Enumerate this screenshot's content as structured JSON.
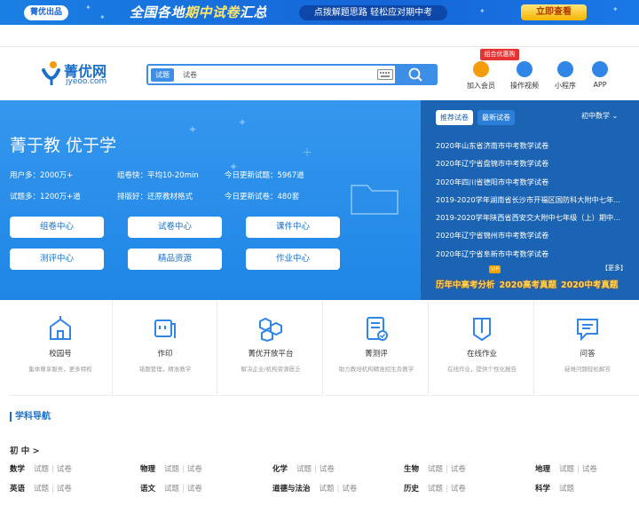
{
  "banner": {
    "chip": "菁优出品",
    "headline_a": "全国各地",
    "headline_b": "期中试卷",
    "headline_c": "汇总",
    "pill": "点拨解题思路  轻松应对期中考",
    "cta": "立即查看"
  },
  "header": {
    "logo_name": "菁优网",
    "logo_domain": "jyeoo.com",
    "search_tabs": [
      "试题",
      "试卷"
    ],
    "promo": "组合优惠购",
    "icons": [
      {
        "label": "加入会员",
        "color": "#f59c0d"
      },
      {
        "label": "操作视频",
        "color": "#2f86e6"
      },
      {
        "label": "小程序",
        "color": "#2f86e6"
      },
      {
        "label": "APP",
        "color": "#2f86e6"
      }
    ]
  },
  "hero": {
    "slogan": "菁于教 优于学",
    "stats": [
      "用户多：2000万+",
      "组卷快：平均10-20min",
      "今日更新试题：5967道",
      "试题多：1200万+道",
      "排版好：还原教材格式",
      "今日更新试卷：480套"
    ],
    "buttons": [
      "组卷中心",
      "试卷中心",
      "课件中心",
      "测评中心",
      "精品资源",
      "作业中心"
    ],
    "tabs": [
      "推荐试卷",
      "最新试卷"
    ],
    "subject": "初中数学",
    "papers": [
      "2020年山东省济南市中考数学试卷",
      "2020年辽宁省盘锦市中考数学试卷",
      "2020年四川省德阳市中考数学试卷",
      "2019-2020学年湖南省长沙市开福区国防科大附中七年...",
      "2019-2020学年陕西省西安交大附中七年级（上）期中...",
      "2020年辽宁省锦州市中考数学试卷",
      "2020年辽宁省阜新市中考数学试卷"
    ],
    "more": "【更多】",
    "vip": "VIP",
    "links": [
      "历年中高考分析",
      "2020高考真题",
      "2020中考真题"
    ]
  },
  "services": [
    {
      "title": "校园号",
      "desc": "集体尊享服务，更多特权"
    },
    {
      "title": "作印",
      "desc": "错题管理，精准教学"
    },
    {
      "title": "菁优开放平台",
      "desc": "解决企业/机构资源匮乏"
    },
    {
      "title": "菁测评",
      "desc": "助力教培机构精准招生及教学"
    },
    {
      "title": "在线作业",
      "desc": "在线作业，提供个性化报告"
    },
    {
      "title": "问答",
      "desc": "疑难问题轻松解答"
    }
  ],
  "nav": {
    "title": "学科导航",
    "level": "初 中 >",
    "link_q": "试题",
    "link_p": "试卷",
    "subjects": [
      {
        "name": "数学",
        "links": [
          "试题",
          "试卷"
        ]
      },
      {
        "name": "物理",
        "links": [
          "试题",
          "试卷"
        ]
      },
      {
        "name": "化学",
        "links": [
          "试题",
          "试卷"
        ]
      },
      {
        "name": "生物",
        "links": [
          "试题",
          "试卷"
        ]
      },
      {
        "name": "地理",
        "links": [
          "试题",
          "试卷"
        ]
      },
      {
        "name": "英语",
        "links": [
          "试题",
          "试卷"
        ]
      },
      {
        "name": "语文",
        "links": [
          "试题",
          "试卷"
        ]
      },
      {
        "name": "道德与法治",
        "links": [
          "试题",
          "试卷"
        ]
      },
      {
        "name": "历史",
        "links": [
          "试题",
          "试卷"
        ]
      },
      {
        "name": "科学",
        "links": [
          "试题"
        ]
      }
    ]
  }
}
